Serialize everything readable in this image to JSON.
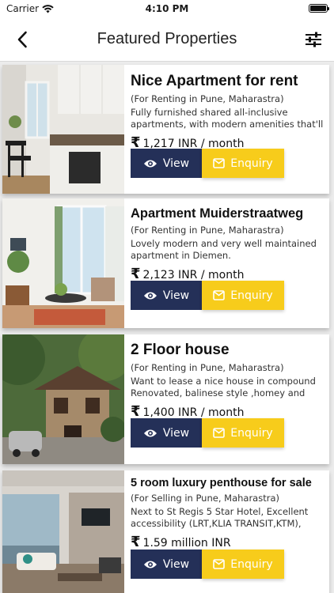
{
  "status_bar": {
    "carrier": "Carrier",
    "time": "4:10 PM"
  },
  "nav": {
    "title": "Featured Properties"
  },
  "buttons": {
    "view": "View",
    "enquiry": "Enquiry"
  },
  "colors": {
    "view_button": "#243058",
    "enquiry_button": "#f7cc1b"
  },
  "listings": [
    {
      "title": "Nice Apartment for rent",
      "subtitle": "(For Renting in Pune, Maharastra)",
      "description": "Fully furnished shared all-inclusive apartments, with modern amenities that'll",
      "price": "1,217 INR / month",
      "image": "apartment-kitchen-photo"
    },
    {
      "title": "Apartment Muiderstraatweg",
      "subtitle": "(For Renting in Pune, Maharastra)",
      "description": "Lovely modern and very well maintained apartment in Diemen.",
      "price": "2,123 INR / month",
      "image": "living-room-photo"
    },
    {
      "title": "2 Floor house",
      "subtitle": "(For Renting in Pune, Maharastra)",
      "description": "Want to lease a nice house in compound Renovated, balinese style ,homey and",
      "price": "1,400 INR / month",
      "image": "house-exterior-photo"
    },
    {
      "title": "5 room luxury penthouse for sale",
      "subtitle": "(For Selling in Pune, Maharastra)",
      "description": "Next to St Regis 5 Star Hotel, Excellent accessibility (LRT,KLIA TRANSIT,KTM),",
      "price": "1.59 million INR",
      "image": "penthouse-interior-photo"
    }
  ]
}
